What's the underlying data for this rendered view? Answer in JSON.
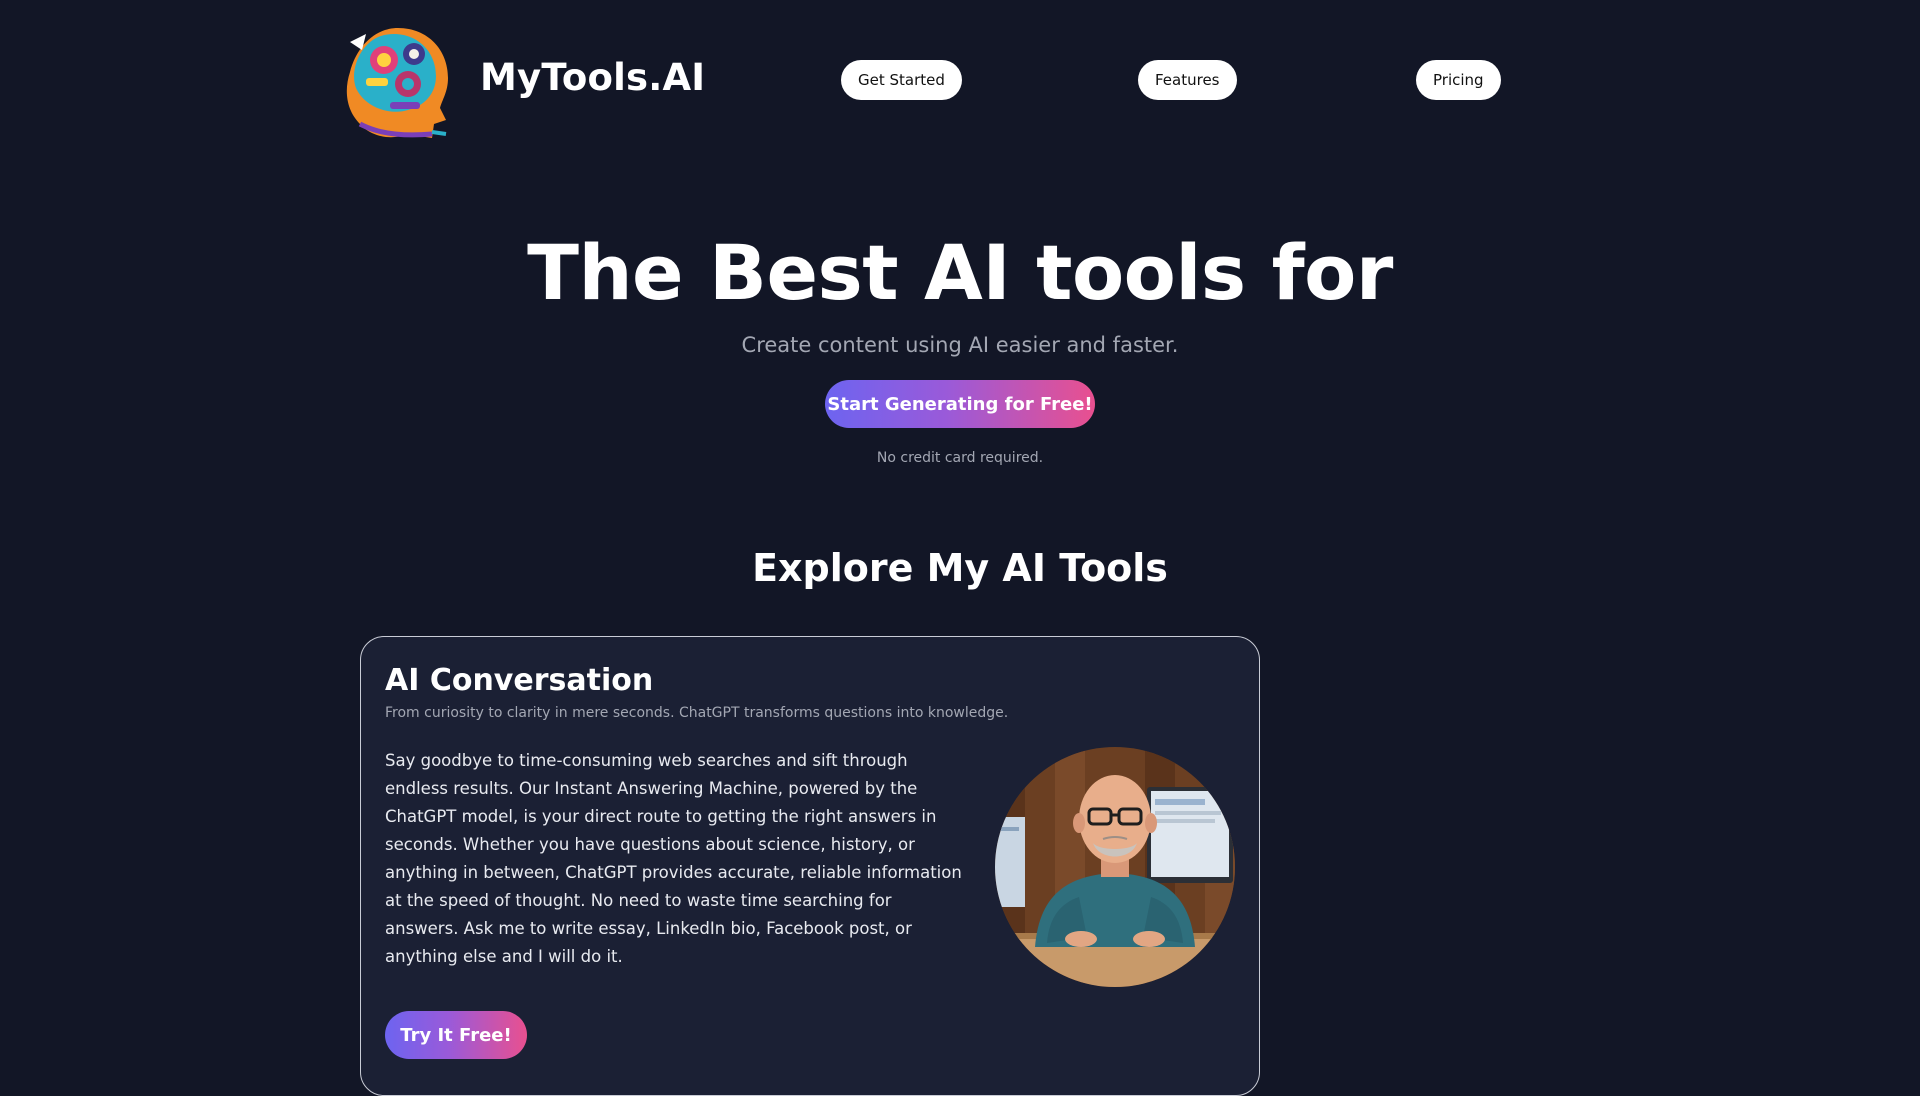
{
  "header": {
    "brand": "MyTools.AI",
    "nav": {
      "get_started": "Get Started",
      "features": "Features",
      "pricing": "Pricing"
    }
  },
  "hero": {
    "title": "The Best AI tools for",
    "subtitle": "Create content using AI easier and faster.",
    "cta_label": "Start Generating for Free!",
    "note": "No credit card required."
  },
  "tools_section": {
    "title": "Explore My AI Tools",
    "cards": [
      {
        "title": "AI Conversation",
        "tagline": "From curiosity to clarity in mere seconds. ChatGPT transforms questions into knowledge.",
        "body": "Say goodbye to time-consuming web searches and sift through endless results. Our Instant Answering Machine, powered by the ChatGPT model, is your direct route to getting the right answers in seconds. Whether you have questions about science, history, or anything in between, ChatGPT provides accurate, reliable information at the speed of thought. No need to waste time searching for answers. Ask me to write essay, LinkedIn bio, Facebook post, or anything else and I will do it.",
        "button_label": "Try It Free!",
        "image": "man-at-computer-illustration"
      }
    ]
  },
  "colors": {
    "background": "#121626",
    "card_background": "#1b2034",
    "gradient_start": "#6d64f0",
    "gradient_end": "#e9508f",
    "muted_text": "#a3a7b3"
  },
  "icons": {
    "logo": "ai-head-logo-icon"
  }
}
